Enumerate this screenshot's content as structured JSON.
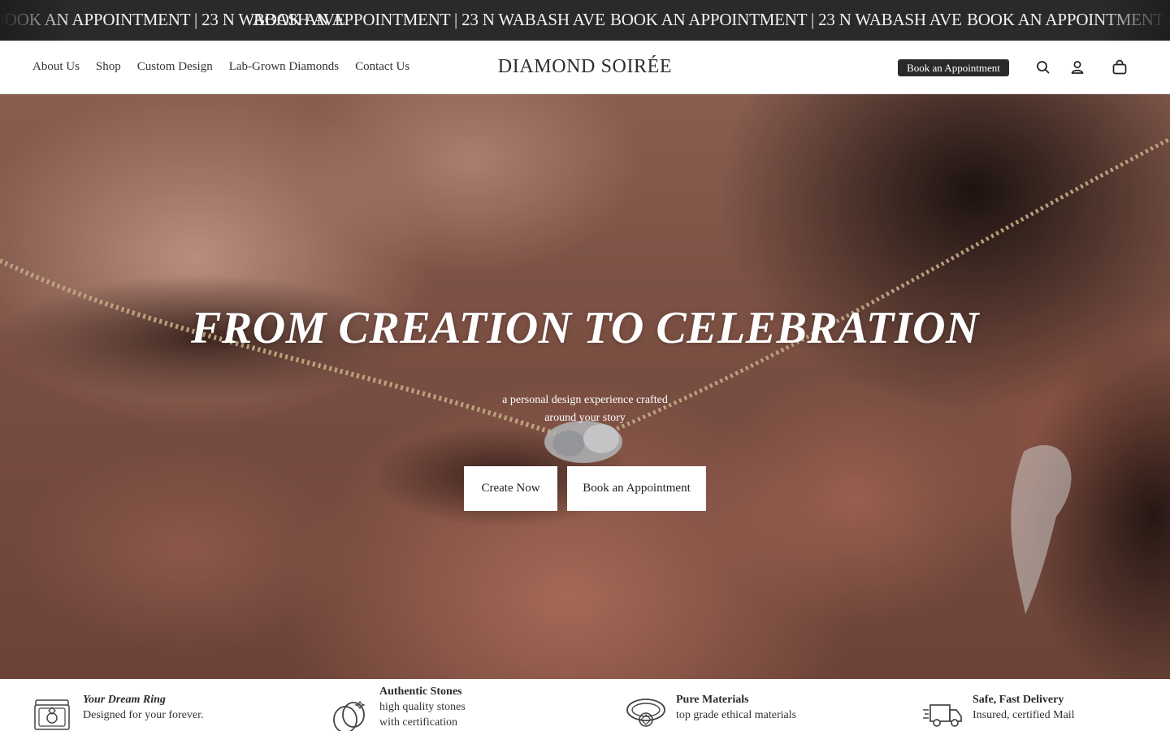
{
  "announcement": {
    "items": [
      "BOOK AN APPOINTMENT | 23 N WABASH AVE",
      "BOOK AN APPOINTMENT | 23 N WABASH AVE",
      "BOOK AN APPOINTMENT | 23 N WABASH AVE",
      "BOOK AN APPOINTMENT | 23 N WABASH AVE"
    ]
  },
  "header": {
    "nav": [
      "About Us",
      "Shop",
      "Custom Design",
      "Lab-Grown Diamonds",
      "Contact Us"
    ],
    "logo": "DIAMOND SOIRÉE",
    "book_label": "Book an Appointment",
    "icons": [
      "search-icon",
      "account-icon",
      "cart-icon"
    ]
  },
  "hero": {
    "title": "FROM CREATION TO CELEBRATION",
    "subtitle_line1": "a personal design experience crafted",
    "subtitle_line2": "around your story",
    "primary_button": "Create Now",
    "secondary_button": "Book an Appointment"
  },
  "features": [
    {
      "icon": "ring-box-icon",
      "title": "Your Dream Ring",
      "title_italic": true,
      "desc1": "Designed for your forever.",
      "desc2": ""
    },
    {
      "icon": "interlocked-rings-icon",
      "title": "Authentic Stones",
      "title_italic": false,
      "desc1": "high quality stones",
      "desc2": "with certification"
    },
    {
      "icon": "diamond-ring-icon",
      "title": "Pure Materials",
      "title_italic": false,
      "desc1": "top grade ethical materials",
      "desc2": ""
    },
    {
      "icon": "delivery-truck-icon",
      "title": "Safe, Fast Delivery",
      "title_italic": false,
      "desc1": "Insured, certified Mail",
      "desc2": ""
    }
  ],
  "colors": {
    "announcement_bg": "#2b2a2a",
    "accent_button": "#2b2a2a",
    "hero_text": "#ffffff"
  }
}
